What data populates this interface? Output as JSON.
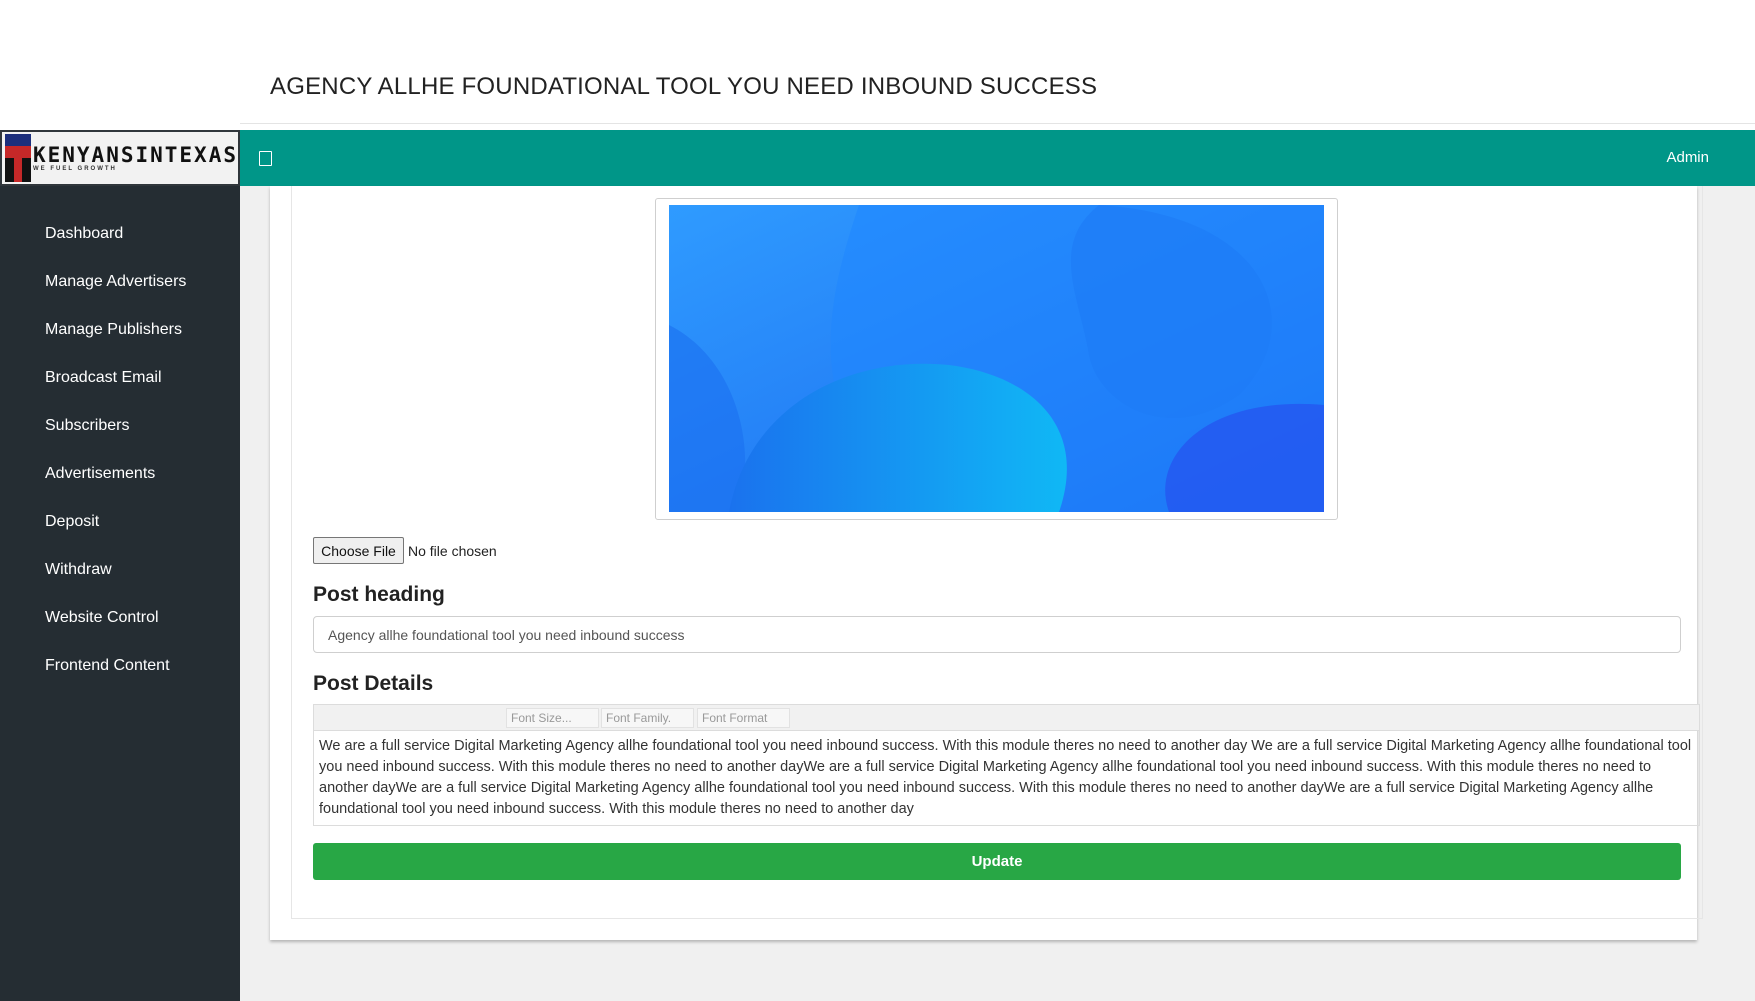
{
  "page": {
    "title": "AGENCY ALLHE FOUNDATIONAL TOOL YOU NEED INBOUND SUCCESS"
  },
  "brand": {
    "logo_text": "KENYANSINTEXAS",
    "tagline": "WE FUEL GROWTH"
  },
  "sidebar": {
    "items": [
      {
        "label": "Dashboard"
      },
      {
        "label": "Manage Advertisers"
      },
      {
        "label": "Manage Publishers"
      },
      {
        "label": "Broadcast Email"
      },
      {
        "label": "Subscribers"
      },
      {
        "label": "Advertisements"
      },
      {
        "label": "Deposit"
      },
      {
        "label": "Withdraw"
      },
      {
        "label": "Website Control"
      },
      {
        "label": "Frontend Content"
      }
    ]
  },
  "topbar": {
    "user_label": "Admin",
    "toggle_icon": "square-icon"
  },
  "form": {
    "file_button_label": "Choose File",
    "file_status": "No file chosen",
    "post_heading_label": "Post heading",
    "post_heading_value": "Agency allhe foundational tool you need inbound success",
    "post_details_label": "Post Details",
    "editor_toolbar": {
      "font_size": "Font Size...",
      "font_family": "Font Family.",
      "font_format": "Font Format"
    },
    "post_details_value": "We are a full service Digital Marketing Agency allhe foundational tool you need inbound success. With this module theres no need to another day We are a full service Digital Marketing Agency allhe foundational tool you need inbound success. With this module theres no need to another dayWe are a full service Digital Marketing Agency allhe foundational tool you need inbound success. With this module theres no need to another dayWe are a full service Digital Marketing Agency allhe foundational tool you need inbound success. With this module theres no need to another dayWe are a full service Digital Marketing Agency allhe foundational tool you need inbound success. With this module theres no need to another day",
    "update_button_label": "Update"
  },
  "colors": {
    "topbar": "#009688",
    "sidebar": "#252d33",
    "update_button": "#28a745"
  }
}
